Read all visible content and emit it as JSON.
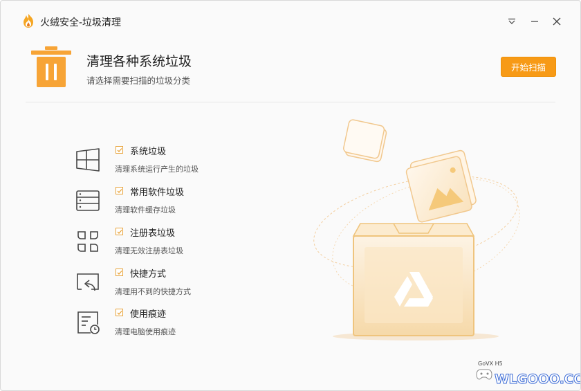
{
  "window": {
    "title": "火绒安全-垃圾清理",
    "controls": [
      "menu-icon",
      "minimize-icon",
      "close-icon"
    ]
  },
  "header": {
    "title": "清理各种系统垃圾",
    "subtitle": "请选择需要扫描的垃圾分类",
    "scan_button": "开始扫描"
  },
  "categories": [
    {
      "icon": "windows-icon",
      "label": "系统垃圾",
      "desc": "清理系统运行产生的垃圾",
      "checked": true
    },
    {
      "icon": "software-list-icon",
      "label": "常用软件垃圾",
      "desc": "清理软件缓存垃圾",
      "checked": true
    },
    {
      "icon": "registry-icon",
      "label": "注册表垃圾",
      "desc": "清理无效注册表垃圾",
      "checked": true
    },
    {
      "icon": "shortcut-icon",
      "label": "快捷方式",
      "desc": "清理用不到的快捷方式",
      "checked": true
    },
    {
      "icon": "usage-trace-icon",
      "label": "使用痕迹",
      "desc": "清理电脑使用痕迹",
      "checked": true
    }
  ],
  "watermark": {
    "text": "WLGOOO.COM",
    "small": "GoVX H5"
  },
  "colors": {
    "accent": "#F79A16",
    "checkbox_border": "#E8A33A",
    "illustration": "#F2C98A"
  }
}
